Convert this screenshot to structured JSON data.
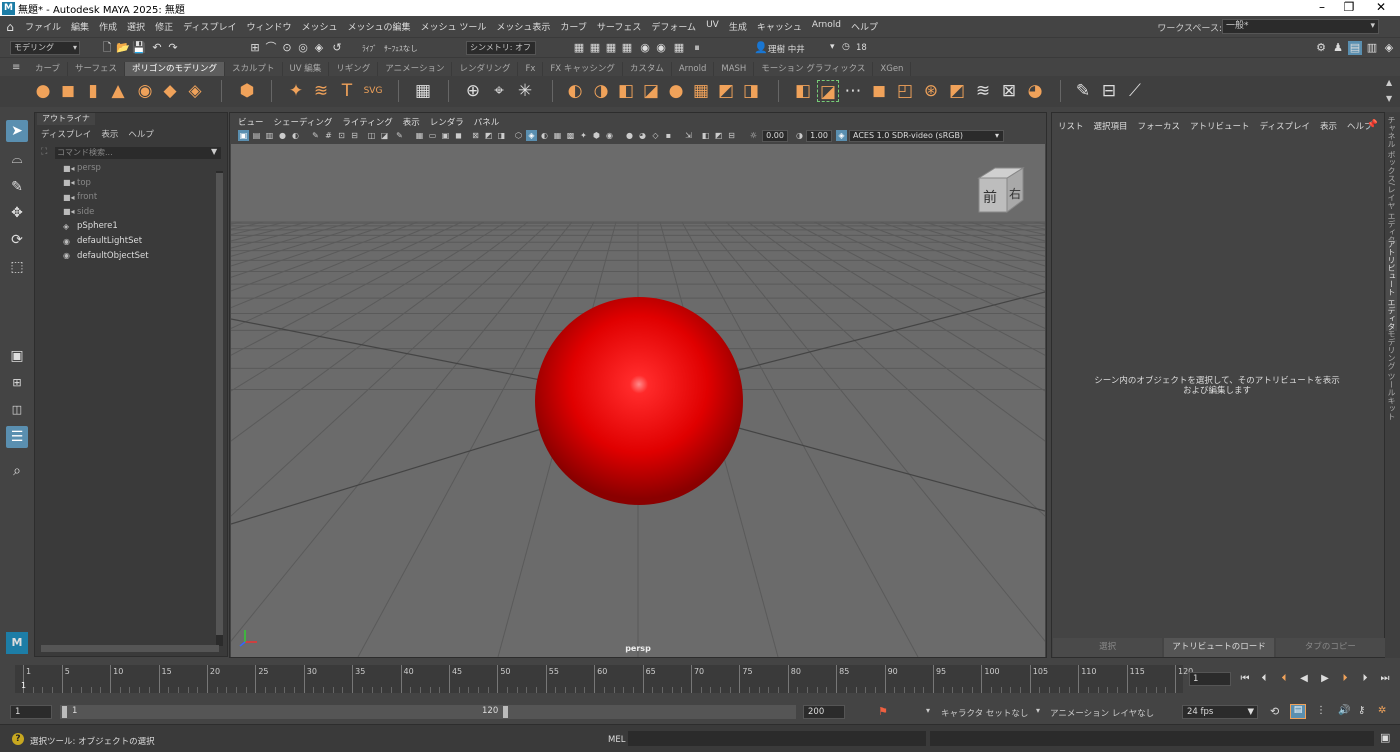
{
  "window": {
    "title": "無題* - Autodesk MAYA 2025: 無題",
    "logo": "M"
  },
  "menubar": [
    "ファイル",
    "編集",
    "作成",
    "選択",
    "修正",
    "ディスプレイ",
    "ウィンドウ",
    "メッシュ",
    "メッシュの編集",
    "メッシュ ツール",
    "メッシュ表示",
    "カーブ",
    "サーフェス",
    "デフォーム",
    "UV",
    "生成",
    "キャッシュ",
    "Arnold",
    "ヘルプ"
  ],
  "workspace": {
    "label": "ワークスペース:",
    "value": "一般*"
  },
  "statusline": {
    "mode": "モデリング",
    "live_label": "ﾗｲﾌﾞ",
    "live_value": "ｻｰﾌｪｽなし",
    "symmetry": "シンメトリ: オフ",
    "user": "理樹 中井",
    "notifications": "18"
  },
  "shelf_tabs": [
    "カーブ",
    "サーフェス",
    "ポリゴンのモデリング",
    "スカルプト",
    "UV 編集",
    "リギング",
    "アニメーション",
    "レンダリング",
    "Fx",
    "FX キャッシング",
    "カスタム",
    "Arnold",
    "MASH",
    "モーション グラフィックス",
    "XGen"
  ],
  "shelf_active": "ポリゴンのモデリング",
  "outliner": {
    "tab": "アウトライナ",
    "menu": [
      "ディスプレイ",
      "表示",
      "ヘルプ"
    ],
    "search_placeholder": "コマンド検索...",
    "items": [
      {
        "name": "persp",
        "icon": "camera-icon",
        "dim": true
      },
      {
        "name": "top",
        "icon": "camera-icon",
        "dim": true
      },
      {
        "name": "front",
        "icon": "camera-icon",
        "dim": true
      },
      {
        "name": "side",
        "icon": "camera-icon",
        "dim": true
      },
      {
        "name": "pSphere1",
        "icon": "mesh-icon",
        "dim": false
      },
      {
        "name": "defaultLightSet",
        "icon": "set-icon",
        "dim": false
      },
      {
        "name": "defaultObjectSet",
        "icon": "set-icon",
        "dim": false
      }
    ]
  },
  "viewport": {
    "menu": [
      "ビュー",
      "シェーディング",
      "ライティング",
      "表示",
      "レンダラ",
      "パネル"
    ],
    "exposure": "0.00",
    "gamma": "1.00",
    "colorspace": "ACES 1.0 SDR-video (sRGB)",
    "camera": "persp",
    "viewcube": {
      "front": "前",
      "right": "右"
    },
    "sphere_color": "#e00000"
  },
  "attribute_editor": {
    "menu": [
      "リスト",
      "選択項目",
      "フォーカス",
      "アトリビュート",
      "ディスプレイ",
      "表示",
      "ヘルプ"
    ],
    "message": "シーン内のオブジェクトを選択して、そのアトリビュートを表示および編集します",
    "buttons": [
      "選択",
      "アトリビュートのロード",
      "タブのコピー"
    ]
  },
  "side_tabs": [
    "チャネル ボックス/レイヤ エディタ",
    "アトリビュート エディタ",
    "モデリング ツールキット"
  ],
  "timeline": {
    "ticks": [
      1,
      5,
      10,
      15,
      20,
      25,
      30,
      35,
      40,
      45,
      50,
      55,
      60,
      65,
      70,
      75,
      80,
      85,
      90,
      95,
      100,
      105,
      110,
      115,
      120
    ],
    "current_frame": "1"
  },
  "range": {
    "start": "1",
    "inner_start": "1",
    "inner_end": "120",
    "end": "200",
    "character": "キャラクタ セットなし",
    "anim_layer": "アニメーション レイヤなし",
    "fps": "24 fps"
  },
  "cmdline": {
    "help": "選択ツール: オブジェクトの選択",
    "lang": "MEL"
  }
}
